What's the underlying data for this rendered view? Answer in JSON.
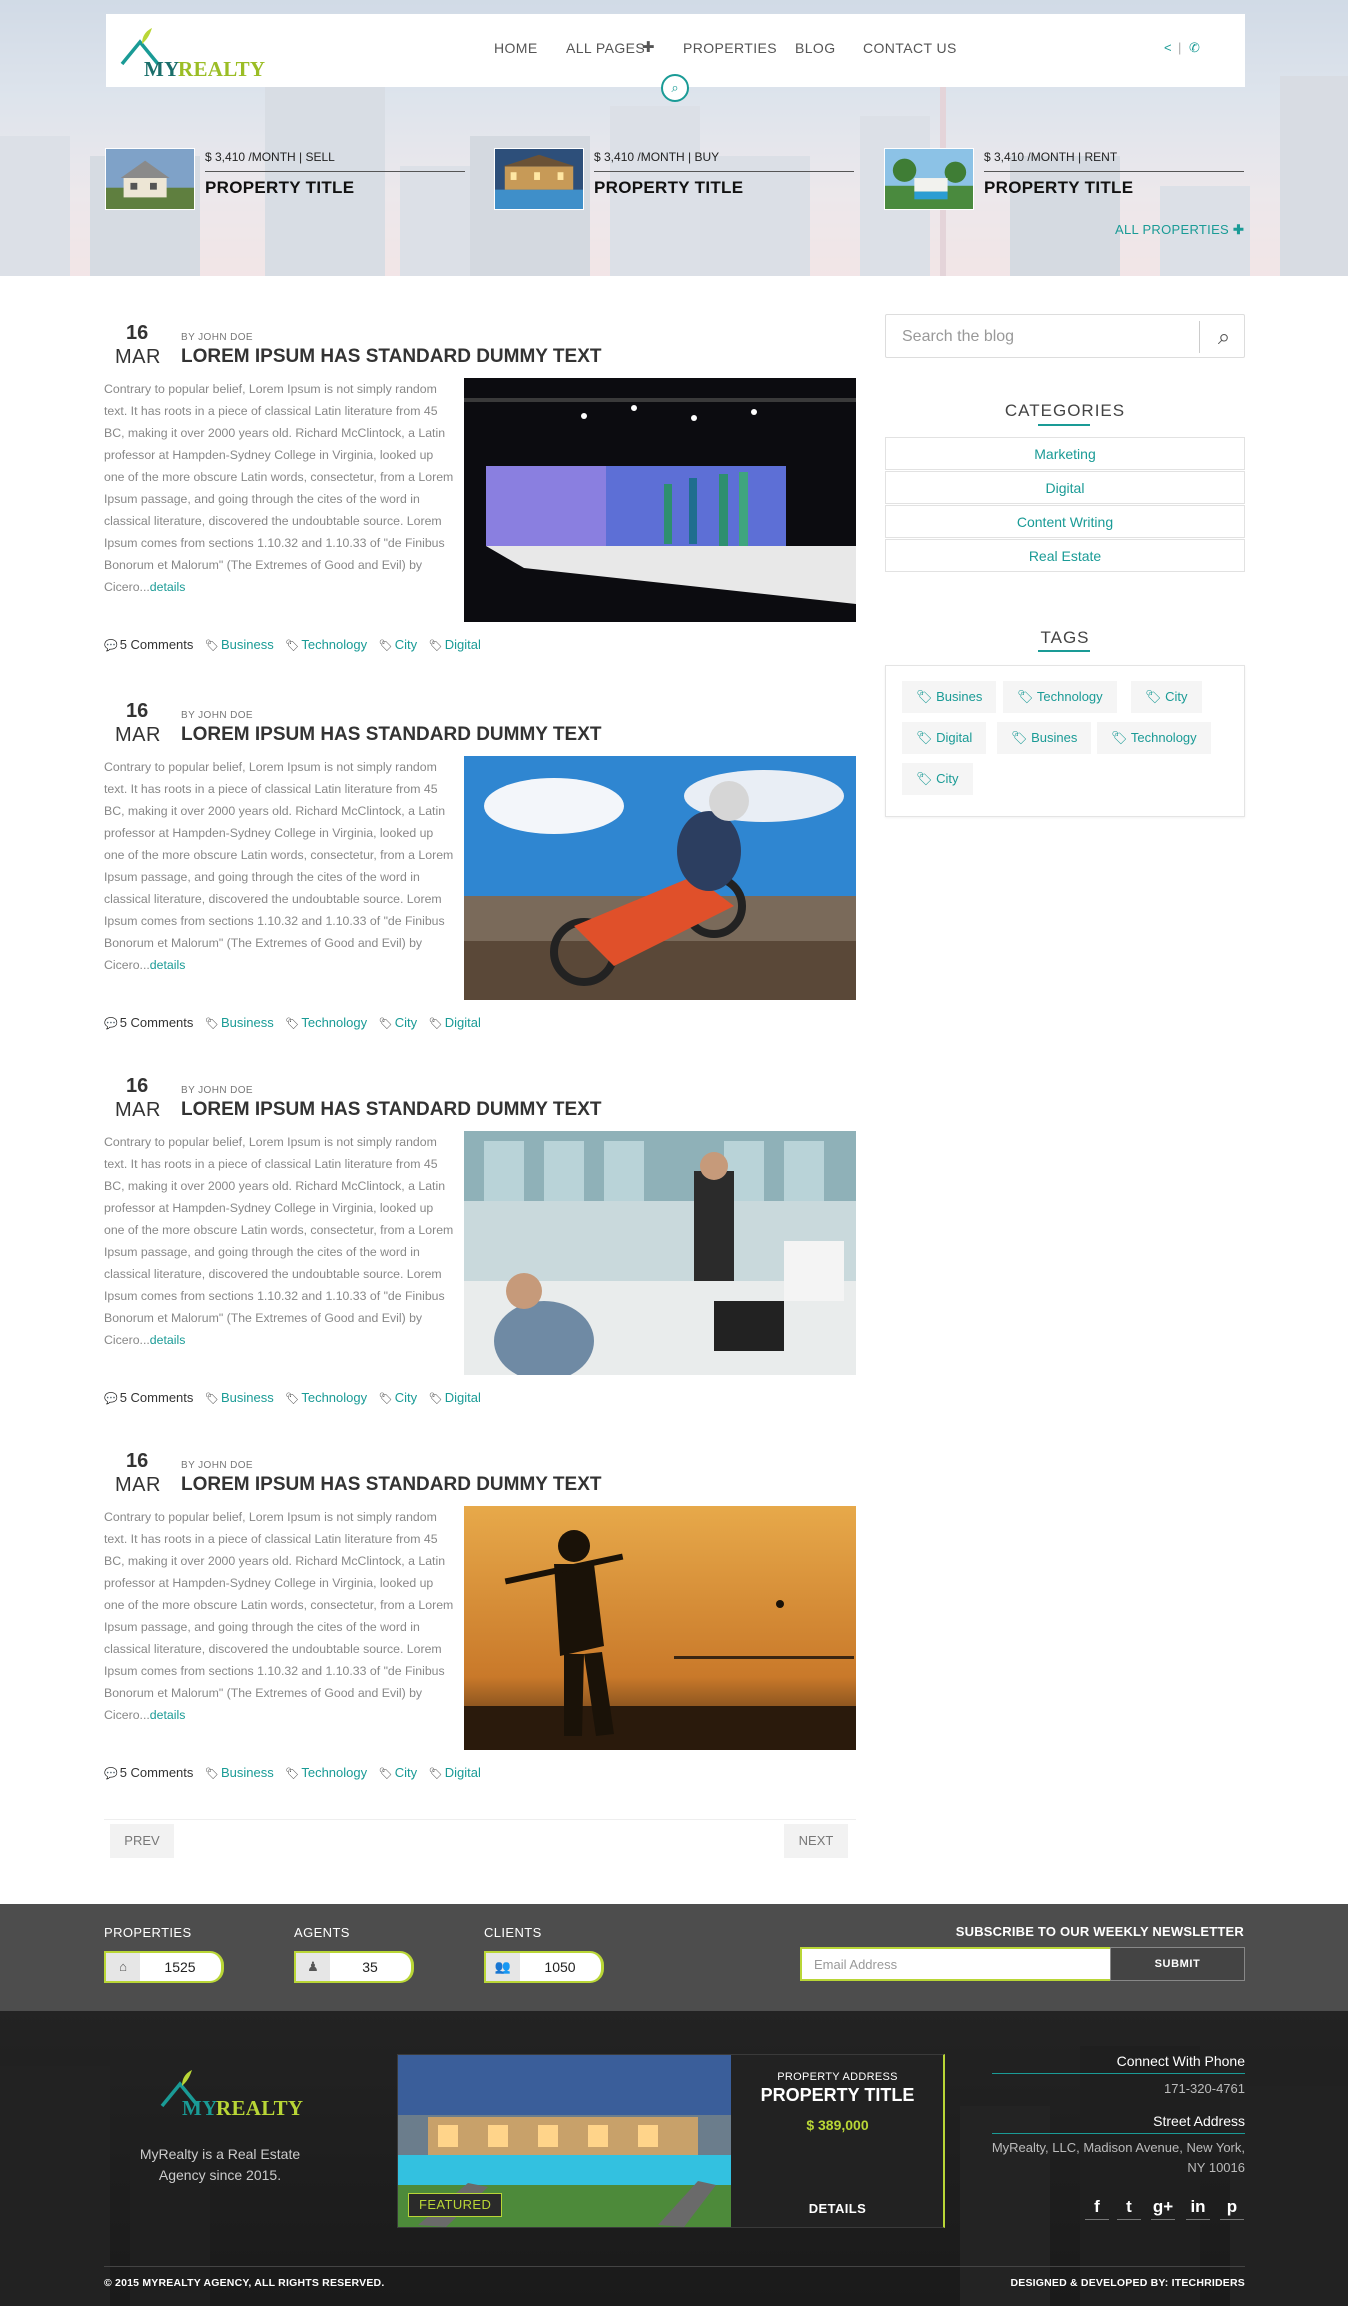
{
  "brand": {
    "logo_my": "MY",
    "logo_realty": "REALTY",
    "accent": "#1a9b96",
    "lime": "#b9d636"
  },
  "nav": {
    "items": [
      "HOME",
      "ALL PAGES",
      "PROPERTIES",
      "BLOG",
      "CONTACT US"
    ],
    "icons": [
      "share-icon",
      "phone-icon",
      "search-icon"
    ]
  },
  "featured": [
    {
      "price": "$ 3,410 /MONTH | SELL",
      "title": "PROPERTY TITLE"
    },
    {
      "price": "$ 3,410 /MONTH | BUY",
      "title": "PROPERTY TITLE"
    },
    {
      "price": "$ 3,410 /MONTH | RENT",
      "title": "PROPERTY TITLE"
    }
  ],
  "all_properties": "ALL PROPERTIES",
  "posts": [
    {
      "day": "16",
      "month": "MAR",
      "author": "BY JOHN DOE",
      "title": "LOREM IPSUM HAS STANDARD DUMMY TEXT",
      "body": "Contrary to popular belief, Lorem Ipsum is not simply random text. It has roots in a piece of classical Latin literature from 45 BC, making it over 2000 years old. Richard McClintock, a Latin professor at Hampden-Sydney College in Virginia, looked up one of the more obscure Latin words, consectetur, from a Lorem Ipsum passage, and going through the cites of the word in classical literature, discovered the undoubtable source. Lorem Ipsum comes from sections 1.10.32 and 1.10.33 of \"de Finibus Bonorum et Malorum\" (The Extremes of Good and Evil) by Cicero...",
      "details": "details",
      "comments": "5 Comments",
      "tags": [
        "Business",
        "Technology",
        "City",
        "Digital"
      ]
    },
    {
      "day": "16",
      "month": "MAR",
      "author": "BY JOHN DOE",
      "title": "LOREM IPSUM HAS STANDARD DUMMY TEXT",
      "body": "Contrary to popular belief, Lorem Ipsum is not simply random text. It has roots in a piece of classical Latin literature from 45 BC, making it over 2000 years old. Richard McClintock, a Latin professor at Hampden-Sydney College in Virginia, looked up one of the more obscure Latin words, consectetur, from a Lorem Ipsum passage, and going through the cites of the word in classical literature, discovered the undoubtable source. Lorem Ipsum comes from sections 1.10.32 and 1.10.33 of \"de Finibus Bonorum et Malorum\" (The Extremes of Good and Evil) by Cicero...",
      "details": "details",
      "comments": "5 Comments",
      "tags": [
        "Business",
        "Technology",
        "City",
        "Digital"
      ]
    },
    {
      "day": "16",
      "month": "MAR",
      "author": "BY JOHN DOE",
      "title": "LOREM IPSUM HAS STANDARD DUMMY TEXT",
      "body": "Contrary to popular belief, Lorem Ipsum is not simply random text. It has roots in a piece of classical Latin literature from 45 BC, making it over 2000 years old. Richard McClintock, a Latin professor at Hampden-Sydney College in Virginia, looked up one of the more obscure Latin words, consectetur, from a Lorem Ipsum passage, and going through the cites of the word in classical literature, discovered the undoubtable source. Lorem Ipsum comes from sections 1.10.32 and 1.10.33 of \"de Finibus Bonorum et Malorum\" (The Extremes of Good and Evil) by Cicero...",
      "details": "details",
      "comments": "5 Comments",
      "tags": [
        "Business",
        "Technology",
        "City",
        "Digital"
      ]
    },
    {
      "day": "16",
      "month": "MAR",
      "author": "BY JOHN DOE",
      "title": "LOREM IPSUM HAS STANDARD DUMMY TEXT",
      "body": "Contrary to popular belief, Lorem Ipsum is not simply random text. It has roots in a piece of classical Latin literature from 45 BC, making it over 2000 years old. Richard McClintock, a Latin professor at Hampden-Sydney College in Virginia, looked up one of the more obscure Latin words, consectetur, from a Lorem Ipsum passage, and going through the cites of the word in classical literature, discovered the undoubtable source. Lorem Ipsum comes from sections 1.10.32 and 1.10.33 of \"de Finibus Bonorum et Malorum\" (The Extremes of Good and Evil) by Cicero...",
      "details": "details",
      "comments": "5 Comments",
      "tags": [
        "Business",
        "Technology",
        "City",
        "Digital"
      ]
    }
  ],
  "pagination": {
    "prev": "PREV",
    "next": "NEXT"
  },
  "sidebar": {
    "search_placeholder": "Search the blog",
    "categories_title": "CATEGORIES",
    "categories": [
      "Marketing",
      "Digital",
      "Content Writing",
      "Real Estate"
    ],
    "tags_title": "TAGS",
    "tags": [
      "Busines",
      "Technology",
      "City",
      "Digital",
      "Busines",
      "Technology",
      "City"
    ]
  },
  "stats": [
    {
      "label": "PROPERTIES",
      "value": "1525",
      "icon": "home-icon"
    },
    {
      "label": "AGENTS",
      "value": "35",
      "icon": "person-icon"
    },
    {
      "label": "CLIENTS",
      "value": "1050",
      "icon": "group-icon"
    }
  ],
  "newsletter": {
    "title": "SUBSCRIBE TO OUR WEEKLY NEWSLETTER",
    "placeholder": "Email Address",
    "submit": "SUBMIT"
  },
  "footer": {
    "about": "MyRealty is a Real Estate Agency since 2015.",
    "card": {
      "address_label": "PROPERTY ADDRESS",
      "title": "PROPERTY TITLE",
      "price": "$ 389,000",
      "details": "DETAILS",
      "badge": "FEATURED"
    },
    "phone_title": "Connect With Phone",
    "phone": "171-320-4761",
    "address_title": "Street Address",
    "address": "MyRealty, LLC, Madison Avenue, New York, NY 10016",
    "social": [
      "f",
      "t",
      "g+",
      "in",
      "p"
    ],
    "copyright": "© 2015 MYREALTY AGENCY, ALL RIGHTS RESERVED.",
    "credit": "DESIGNED & DEVELOPED BY: ITECHRIDERS"
  }
}
